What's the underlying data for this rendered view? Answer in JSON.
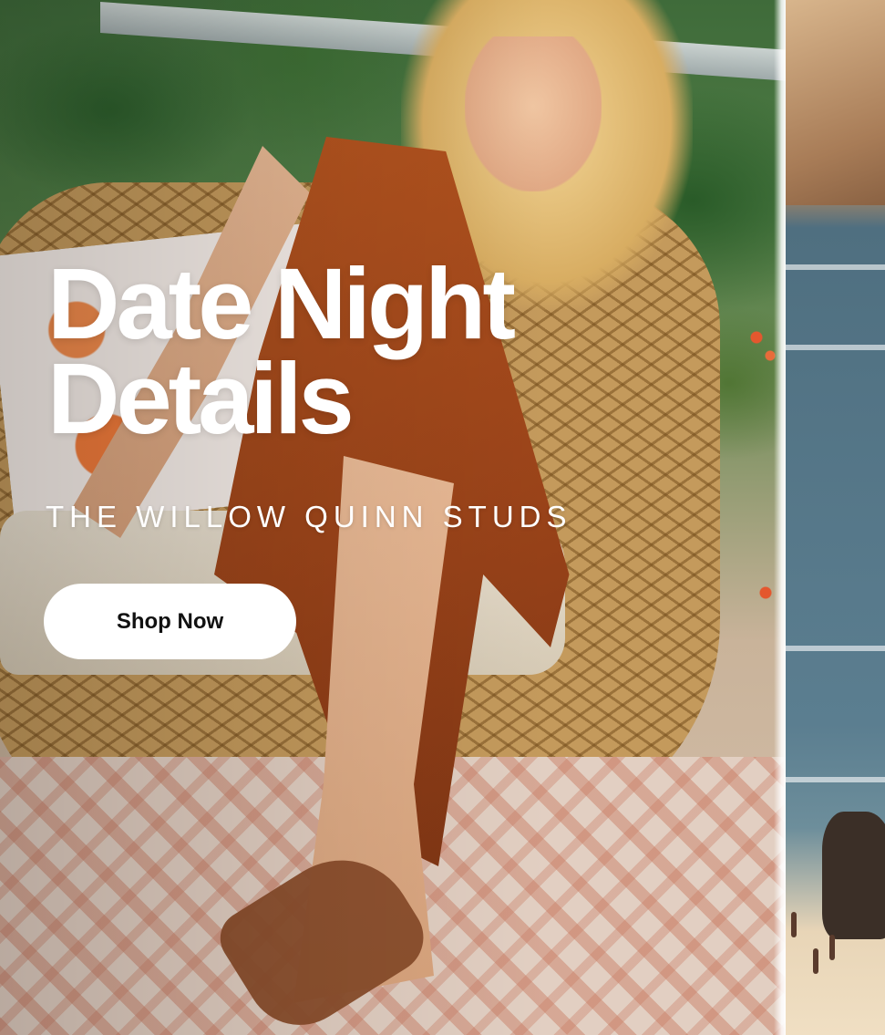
{
  "hero": {
    "headline_line1": "Date Night",
    "headline_line2": "Details",
    "subheadline": "THE WILLOW QUINN STUDS",
    "cta_label": "Shop Now"
  },
  "colors": {
    "text": "#ffffff",
    "button_bg": "#ffffff",
    "button_text": "#111111"
  }
}
